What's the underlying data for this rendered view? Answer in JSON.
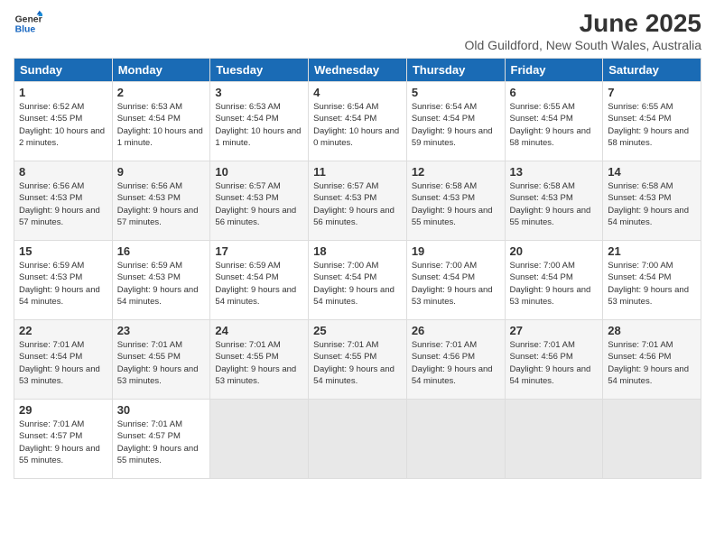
{
  "header": {
    "logo_line1": "General",
    "logo_line2": "Blue",
    "title": "June 2025",
    "subtitle": "Old Guildford, New South Wales, Australia"
  },
  "weekdays": [
    "Sunday",
    "Monday",
    "Tuesday",
    "Wednesday",
    "Thursday",
    "Friday",
    "Saturday"
  ],
  "weeks": [
    [
      {
        "day": 1,
        "sunrise": "6:52 AM",
        "sunset": "4:55 PM",
        "daylight": "Daylight: 10 hours and 2 minutes."
      },
      {
        "day": 2,
        "sunrise": "6:53 AM",
        "sunset": "4:54 PM",
        "daylight": "Daylight: 10 hours and 1 minute."
      },
      {
        "day": 3,
        "sunrise": "6:53 AM",
        "sunset": "4:54 PM",
        "daylight": "Daylight: 10 hours and 1 minute."
      },
      {
        "day": 4,
        "sunrise": "6:54 AM",
        "sunset": "4:54 PM",
        "daylight": "Daylight: 10 hours and 0 minutes."
      },
      {
        "day": 5,
        "sunrise": "6:54 AM",
        "sunset": "4:54 PM",
        "daylight": "Daylight: 9 hours and 59 minutes."
      },
      {
        "day": 6,
        "sunrise": "6:55 AM",
        "sunset": "4:54 PM",
        "daylight": "Daylight: 9 hours and 58 minutes."
      },
      {
        "day": 7,
        "sunrise": "6:55 AM",
        "sunset": "4:54 PM",
        "daylight": "Daylight: 9 hours and 58 minutes."
      }
    ],
    [
      {
        "day": 8,
        "sunrise": "6:56 AM",
        "sunset": "4:53 PM",
        "daylight": "Daylight: 9 hours and 57 minutes."
      },
      {
        "day": 9,
        "sunrise": "6:56 AM",
        "sunset": "4:53 PM",
        "daylight": "Daylight: 9 hours and 57 minutes."
      },
      {
        "day": 10,
        "sunrise": "6:57 AM",
        "sunset": "4:53 PM",
        "daylight": "Daylight: 9 hours and 56 minutes."
      },
      {
        "day": 11,
        "sunrise": "6:57 AM",
        "sunset": "4:53 PM",
        "daylight": "Daylight: 9 hours and 56 minutes."
      },
      {
        "day": 12,
        "sunrise": "6:58 AM",
        "sunset": "4:53 PM",
        "daylight": "Daylight: 9 hours and 55 minutes."
      },
      {
        "day": 13,
        "sunrise": "6:58 AM",
        "sunset": "4:53 PM",
        "daylight": "Daylight: 9 hours and 55 minutes."
      },
      {
        "day": 14,
        "sunrise": "6:58 AM",
        "sunset": "4:53 PM",
        "daylight": "Daylight: 9 hours and 54 minutes."
      }
    ],
    [
      {
        "day": 15,
        "sunrise": "6:59 AM",
        "sunset": "4:53 PM",
        "daylight": "Daylight: 9 hours and 54 minutes."
      },
      {
        "day": 16,
        "sunrise": "6:59 AM",
        "sunset": "4:53 PM",
        "daylight": "Daylight: 9 hours and 54 minutes."
      },
      {
        "day": 17,
        "sunrise": "6:59 AM",
        "sunset": "4:54 PM",
        "daylight": "Daylight: 9 hours and 54 minutes."
      },
      {
        "day": 18,
        "sunrise": "7:00 AM",
        "sunset": "4:54 PM",
        "daylight": "Daylight: 9 hours and 54 minutes."
      },
      {
        "day": 19,
        "sunrise": "7:00 AM",
        "sunset": "4:54 PM",
        "daylight": "Daylight: 9 hours and 53 minutes."
      },
      {
        "day": 20,
        "sunrise": "7:00 AM",
        "sunset": "4:54 PM",
        "daylight": "Daylight: 9 hours and 53 minutes."
      },
      {
        "day": 21,
        "sunrise": "7:00 AM",
        "sunset": "4:54 PM",
        "daylight": "Daylight: 9 hours and 53 minutes."
      }
    ],
    [
      {
        "day": 22,
        "sunrise": "7:01 AM",
        "sunset": "4:54 PM",
        "daylight": "Daylight: 9 hours and 53 minutes."
      },
      {
        "day": 23,
        "sunrise": "7:01 AM",
        "sunset": "4:55 PM",
        "daylight": "Daylight: 9 hours and 53 minutes."
      },
      {
        "day": 24,
        "sunrise": "7:01 AM",
        "sunset": "4:55 PM",
        "daylight": "Daylight: 9 hours and 53 minutes."
      },
      {
        "day": 25,
        "sunrise": "7:01 AM",
        "sunset": "4:55 PM",
        "daylight": "Daylight: 9 hours and 54 minutes."
      },
      {
        "day": 26,
        "sunrise": "7:01 AM",
        "sunset": "4:56 PM",
        "daylight": "Daylight: 9 hours and 54 minutes."
      },
      {
        "day": 27,
        "sunrise": "7:01 AM",
        "sunset": "4:56 PM",
        "daylight": "Daylight: 9 hours and 54 minutes."
      },
      {
        "day": 28,
        "sunrise": "7:01 AM",
        "sunset": "4:56 PM",
        "daylight": "Daylight: 9 hours and 54 minutes."
      }
    ],
    [
      {
        "day": 29,
        "sunrise": "7:01 AM",
        "sunset": "4:57 PM",
        "daylight": "Daylight: 9 hours and 55 minutes."
      },
      {
        "day": 30,
        "sunrise": "7:01 AM",
        "sunset": "4:57 PM",
        "daylight": "Daylight: 9 hours and 55 minutes."
      },
      null,
      null,
      null,
      null,
      null
    ]
  ]
}
